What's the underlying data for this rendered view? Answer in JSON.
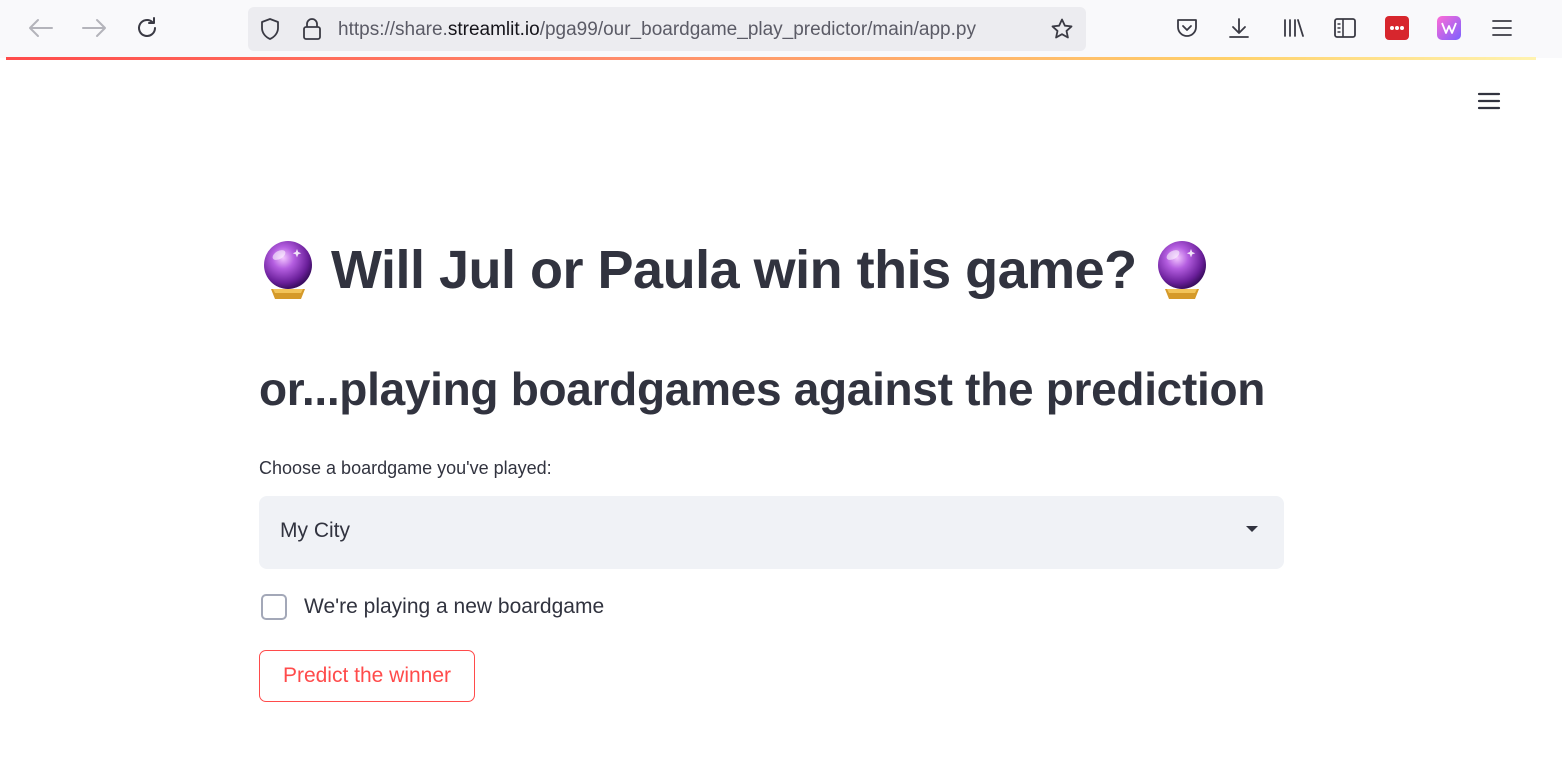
{
  "browser": {
    "url_prefix": "https://share.",
    "url_domain": "streamlit.io",
    "url_path": "/pga99/our_boardgame_play_predictor/main/app.py",
    "icons": [
      "back-arrow-icon",
      "forward-arrow-icon",
      "reload-icon",
      "shield-icon",
      "lock-icon",
      "bookmark-star-icon",
      "pocket-icon",
      "download-icon",
      "library-icon",
      "sidebar-icon",
      "extension-lastpass-icon",
      "extension-purple-icon",
      "hamburger-menu-icon"
    ],
    "accent_gradient": [
      "#ff4b4b",
      "#ffd16a"
    ]
  },
  "app": {
    "title": "Will Jul or Paula win this game?",
    "title_emoji": "crystal-ball-icon",
    "subtitle": "or...playing boardgames against the prediction",
    "select": {
      "label": "Choose a boardgame you've played:",
      "value": "My City"
    },
    "checkbox": {
      "label": "We're playing a new boardgame",
      "checked": false
    },
    "button": {
      "label": "Predict the winner",
      "color": "#ff4b4b"
    },
    "menu_icon": "hamburger-menu-icon"
  }
}
